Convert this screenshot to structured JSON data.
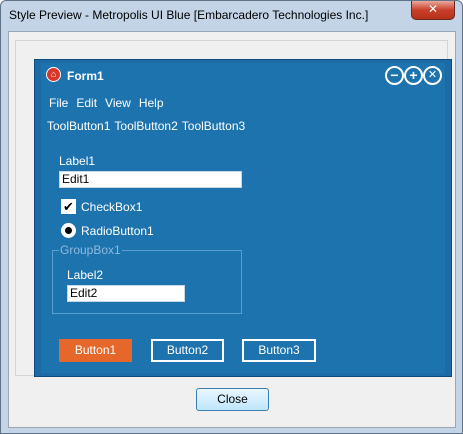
{
  "window": {
    "title": "Style Preview - Metropolis UI Blue [Embarcadero Technologies Inc.]",
    "close_glyph": "✕"
  },
  "form": {
    "title": "Form1",
    "icon": "bank-icon",
    "caption_buttons": {
      "minimize": "−",
      "maximize": "+",
      "close": "✕"
    },
    "menu": [
      "File",
      "Edit",
      "View",
      "Help"
    ],
    "toolbar": [
      "ToolButton1",
      "ToolButton2",
      "ToolButton3"
    ],
    "label1": "Label1",
    "edit1": "Edit1",
    "checkbox": {
      "label": "CheckBox1",
      "checked": true,
      "glyph": "✔"
    },
    "radio": {
      "label": "RadioButton1",
      "checked": true
    },
    "groupbox": {
      "title": "GroupBox1",
      "label2": "Label2",
      "edit2": "Edit2"
    },
    "buttons": [
      "Button1",
      "Button2",
      "Button3"
    ]
  },
  "footer": {
    "close_label": "Close"
  },
  "colors": {
    "form_bg": "#1d73ae",
    "accent_button": "#e5672a"
  }
}
